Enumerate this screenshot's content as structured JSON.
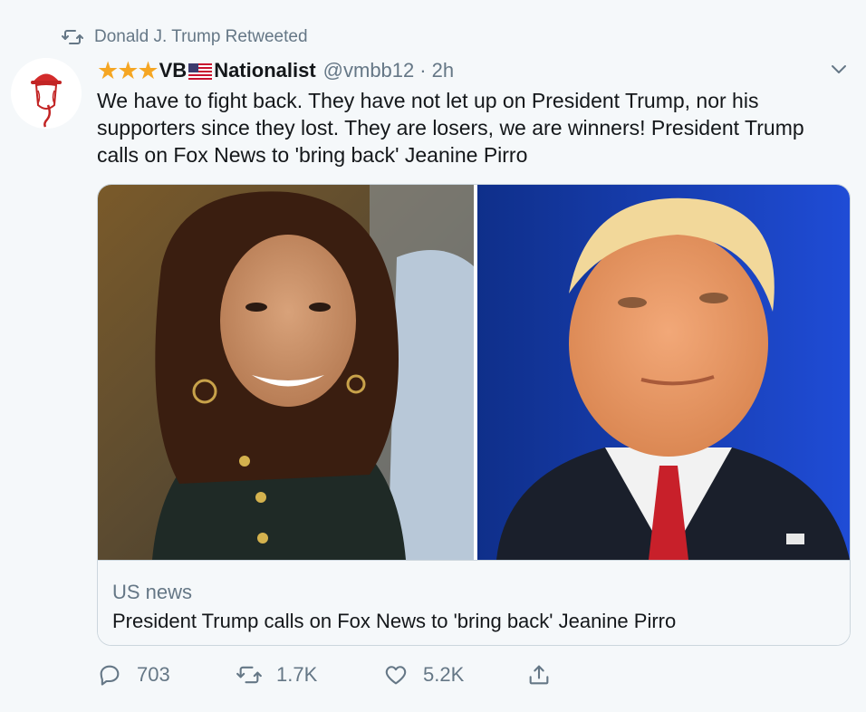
{
  "retweet": {
    "icon": "retweet-icon",
    "text": "Donald J. Trump Retweeted"
  },
  "author": {
    "stars": "★★★",
    "name_prefix": "VB",
    "flag": "us-flag",
    "name_suffix": "Nationalist",
    "handle": "@vmbb12",
    "separator": "·",
    "time": "2h"
  },
  "tweet": {
    "text": "We have to fight back. They have not let up on President Trump, nor his supporters since they lost. They are losers, we are winners! President Trump calls on Fox News to 'bring back' Jeanine Pirro"
  },
  "card": {
    "source": "US news",
    "title": "President Trump calls on Fox News to 'bring back' Jeanine Pirro"
  },
  "actions": {
    "reply_count": "703",
    "retweet_count": "1.7K",
    "like_count": "5.2K"
  },
  "colors": {
    "background": "#f5f8fa",
    "muted": "#657786",
    "text": "#14171a",
    "star": "#f5a623",
    "border": "#ccd6dd"
  }
}
